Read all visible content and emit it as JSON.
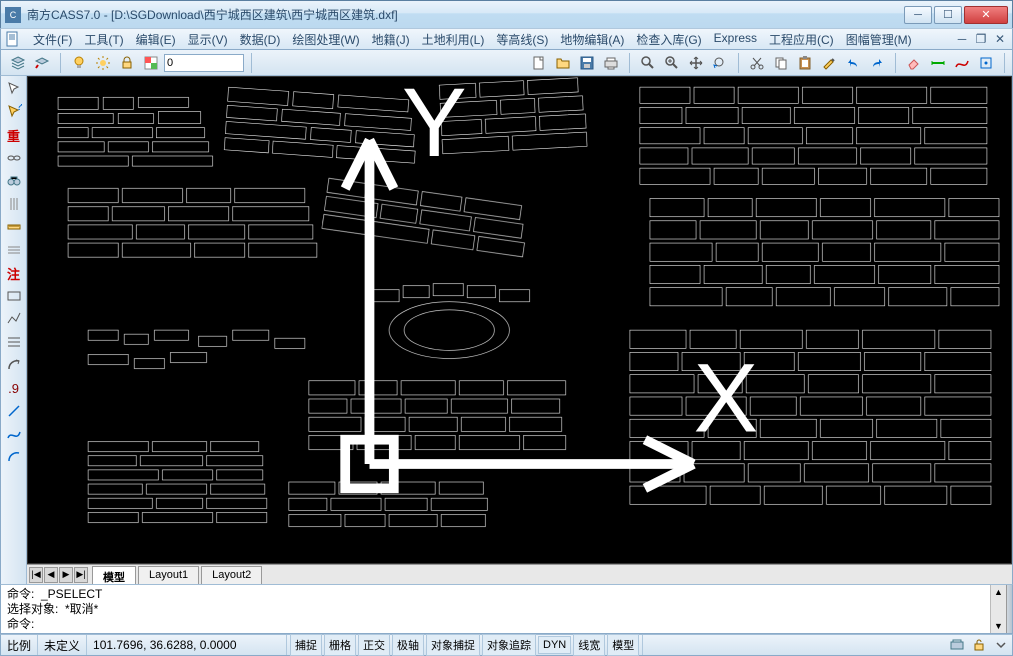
{
  "window": {
    "title": "南方CASS7.0 - [D:\\SGDownload\\西宁城西区建筑\\西宁城西区建筑.dxf]",
    "min": "─",
    "max": "☐",
    "close": "✕"
  },
  "menu": {
    "items": [
      "文件(F)",
      "工具(T)",
      "编辑(E)",
      "显示(V)",
      "数据(D)",
      "绘图处理(W)",
      "地籍(J)",
      "土地利用(L)",
      "等高线(S)",
      "地物编辑(A)",
      "检查入库(G)",
      "Express",
      "工程应用(C)",
      "图幅管理(M)"
    ],
    "mdi_min": "─",
    "mdi_restore": "❐",
    "mdi_close": "✕"
  },
  "toolbar": {
    "layer_combo": "0"
  },
  "left_tool_labels": {
    "chong": "重",
    "zhu": "注",
    "nine": ".9"
  },
  "tabs": {
    "nav": [
      "|◀",
      "◀",
      "▶",
      "▶|"
    ],
    "items": [
      "模型",
      "Layout1",
      "Layout2"
    ],
    "active_index": 0
  },
  "command": {
    "line1": "命令:  _PSELECT",
    "line2": "选择对象:  *取消*",
    "prompt": "命令:"
  },
  "status": {
    "scale_label": "比例",
    "scale_value": "未定义",
    "coords": "101.7696, 36.6288, 0.0000",
    "toggles": [
      "捕捉",
      "栅格",
      "正交",
      "极轴",
      "对象捕捉",
      "对象追踪",
      "DYN",
      "线宽",
      "模型"
    ]
  }
}
